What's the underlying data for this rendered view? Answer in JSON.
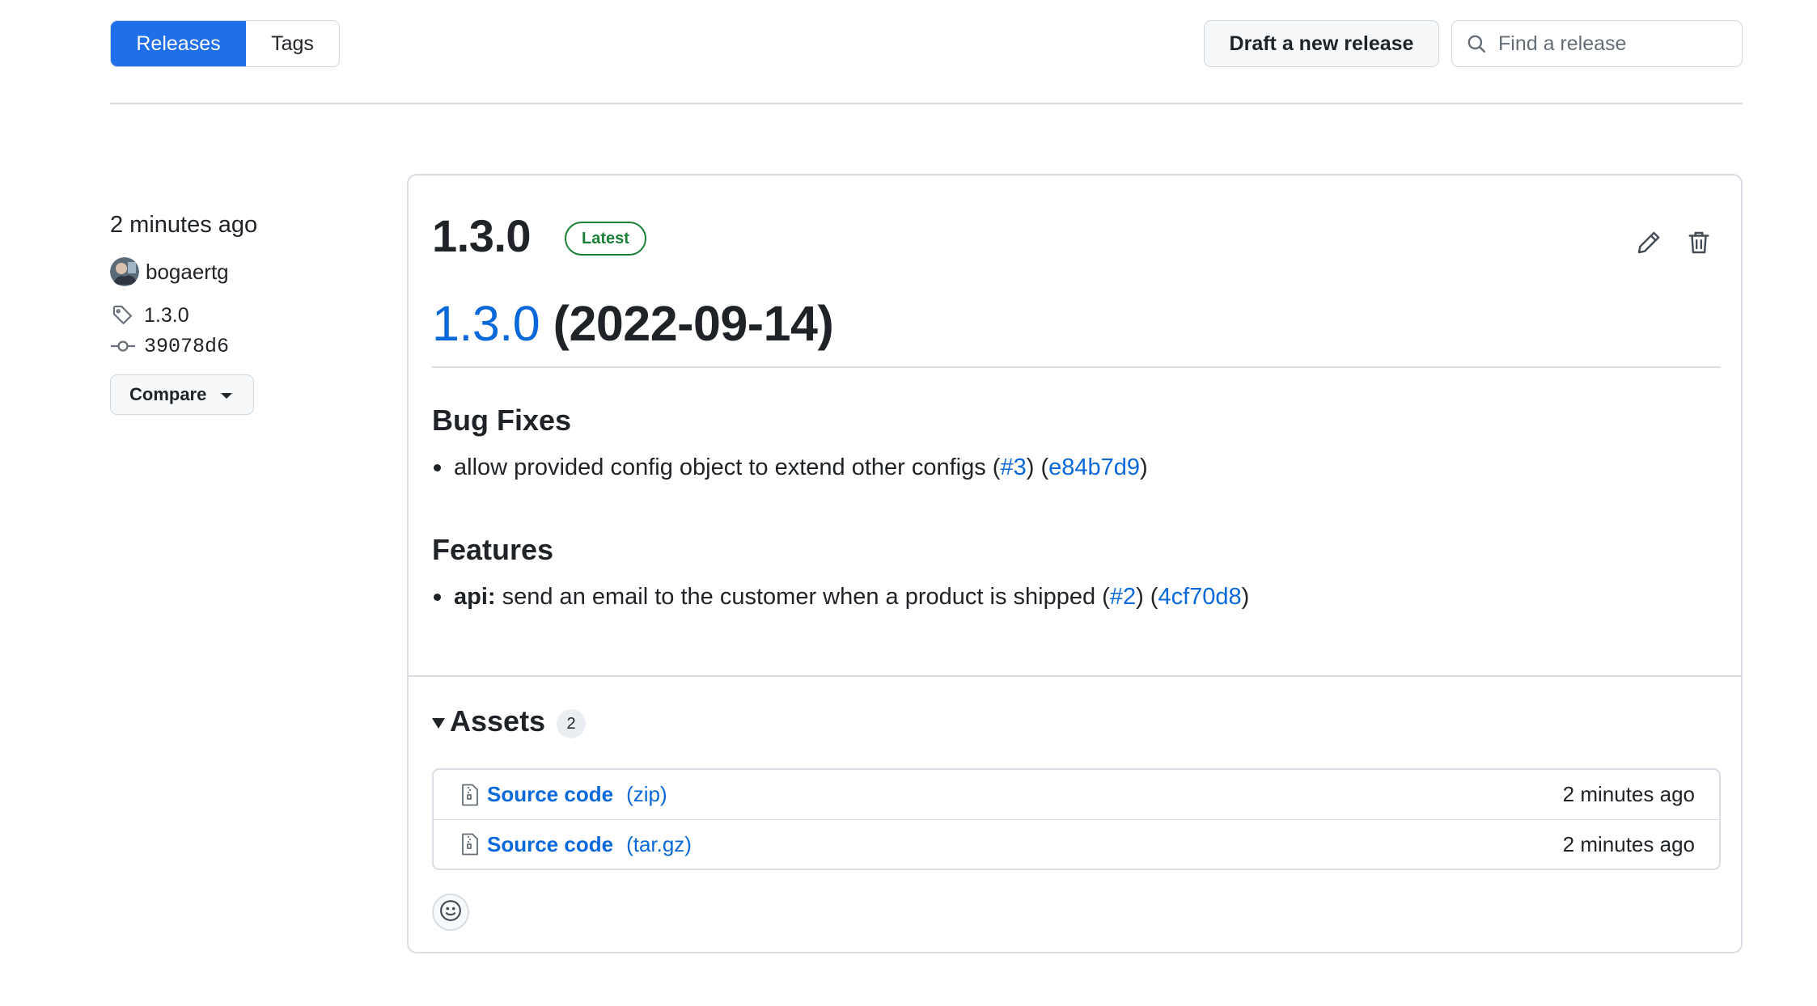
{
  "header": {
    "tabs": [
      {
        "label": "Releases",
        "active": true
      },
      {
        "label": "Tags",
        "active": false
      }
    ],
    "draft_button": "Draft a new release",
    "search": {
      "placeholder": "Find a release",
      "icon": "search-icon"
    }
  },
  "sidebar": {
    "time": "2 minutes ago",
    "author": "bogaertg",
    "tag": "1.3.0",
    "commit": "39078d6",
    "compare_label": "Compare"
  },
  "release": {
    "title": "1.3.0",
    "badge": "Latest",
    "heading_link": "1.3.0",
    "heading_date": "(2022-09-14)",
    "sections": [
      {
        "title": "Bug Fixes",
        "items": [
          {
            "prefix": "",
            "text": "allow provided config object to extend other configs (",
            "issue": "#3",
            "mid": ") (",
            "commit": "e84b7d9",
            "end": ")"
          }
        ]
      },
      {
        "title": "Features",
        "items": [
          {
            "prefix": "api:",
            "text": " send an email to the customer when a product is shipped (",
            "issue": "#2",
            "mid": ") (",
            "commit": "4cf70d8",
            "end": ")"
          }
        ]
      }
    ],
    "assets": {
      "label": "Assets",
      "count": "2",
      "files": [
        {
          "name": "Source code",
          "ext": "(zip)",
          "time": "2 minutes ago"
        },
        {
          "name": "Source code",
          "ext": "(tar.gz)",
          "time": "2 minutes ago"
        }
      ]
    }
  },
  "colors": {
    "accent": "#1f6feb",
    "link": "#0969da",
    "latest_badge": "#1a7f37",
    "border": "#d0d7de"
  }
}
